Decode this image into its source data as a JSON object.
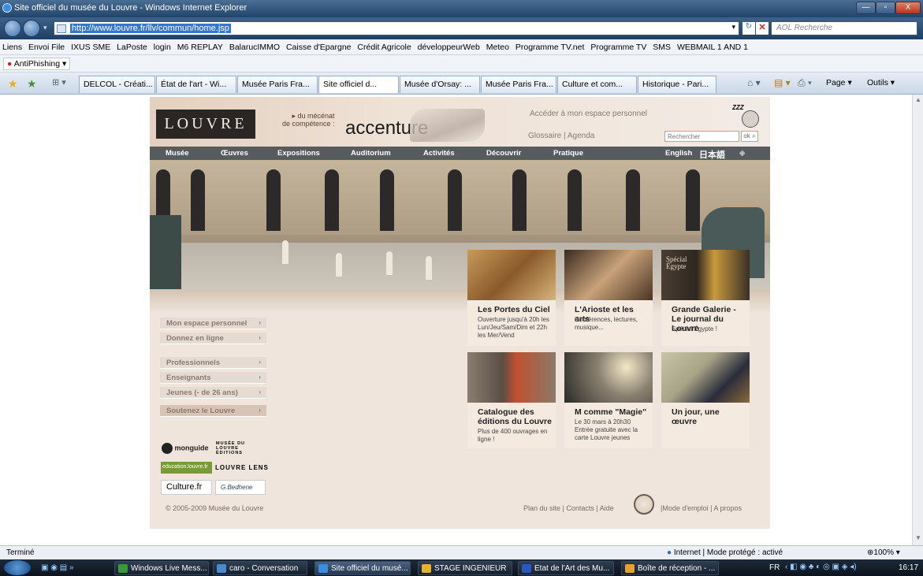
{
  "window": {
    "title": "Site officiel du musée du Louvre - Windows Internet Explorer",
    "btn_min": "—",
    "btn_max": "▫",
    "btn_close": "X"
  },
  "address": {
    "url": "http://www.louvre.fr/llv/commun/home.jsp",
    "search_placeholder": "AOL Recherche"
  },
  "links_bar": [
    "Liens",
    "Envoi File",
    "IXUS SME",
    "LaPoste",
    "login",
    "M6 REPLAY",
    "BalarucIMMO",
    "Caisse d'Epargne",
    "Crédit Agricole",
    "développeurWeb",
    "Meteo",
    "Programme TV.net",
    "Programme TV",
    "SMS",
    "WEBMAIL 1 AND 1"
  ],
  "antiphishing": "AntiPhishing",
  "tabs": [
    "DELCOL - Créati...",
    "État de l'art - Wi...",
    "Musée Paris Fra...",
    "Site officiel d...",
    "Musée d'Orsay: ...",
    "Musée Paris Fra...",
    "Culture et com...",
    "Historique - Pari..."
  ],
  "tab_tools": {
    "page": "Page ▾",
    "tools": "Outils ▾"
  },
  "louvre": {
    "logo": "LOUVRE",
    "mecenat_line1": "▸ du mécénat",
    "mecenat_line2": "de compétence :",
    "sponsor": "accenture",
    "espace": "Accéder à mon espace personnel",
    "glossaire": "Glossaire",
    "agenda": "Agenda",
    "search_placeholder": "Rechercher",
    "ok": "ok",
    "zzz": "ZZZ",
    "nav": [
      "Musée",
      "Œuvres",
      "Expositions",
      "Auditorium",
      "Activités",
      "Découvrir",
      "Pratique"
    ],
    "lang_en": "English",
    "lang_jp": "日本語",
    "menu": [
      "Mon espace personnel",
      "Donnez en ligne",
      "Professionnels",
      "Enseignants",
      "Jeunes (- de 26 ans)",
      "Soutenez le Louvre"
    ],
    "tiles": [
      {
        "title": "Les Portes du Ciel",
        "sub": "Ouverture jusqu'à 20h les Lun/Jeu/Sam/Dim et 22h les Mer/Vend"
      },
      {
        "title": "L'Arioste et les arts",
        "sub": "Conférences, lectures, musique..."
      },
      {
        "title": "Grande Galerie - Le journal du Louvre",
        "sub": "Spécial Égypte !",
        "img_text": "Spécial Égypte"
      },
      {
        "title": "Catalogue des éditions du Louvre",
        "sub": "Plus de 400 ouvrages en ligne !"
      },
      {
        "title": "M comme \"Magie\"",
        "sub": "Le 30 mars à 20h30 Entrée gratuite avec la carte Louvre jeunes"
      },
      {
        "title": "Un jour, une œuvre",
        "sub": ""
      }
    ],
    "logos": {
      "monguide": "monguide",
      "editions1": "MUSÉE DU",
      "editions2": "LOUVRE",
      "editions3": "ÉDITIONS",
      "education": "education.louvre.fr",
      "lens": "LOUVRE LENS",
      "culture": "Culture.fr",
      "signature": "G.Bedhene"
    },
    "copyright": "© 2005-2009 Musée du Louvre",
    "footer_links": [
      "Plan du site",
      "Contacts",
      "Aide"
    ],
    "footer_links2": [
      "Mode d'emploi",
      "A propos"
    ]
  },
  "status": {
    "left": "Terminé",
    "zone": "Internet | Mode protégé : activé",
    "zoom": "100%"
  },
  "taskbar": {
    "items": [
      "Windows Live Mess...",
      "caro - Conversation",
      "Site officiel du musé...",
      "STAGE INGENIEUR",
      "Etat de l'Art des Mu...",
      "Boîte de réception - ..."
    ],
    "lang": "FR",
    "time": "16:17"
  }
}
